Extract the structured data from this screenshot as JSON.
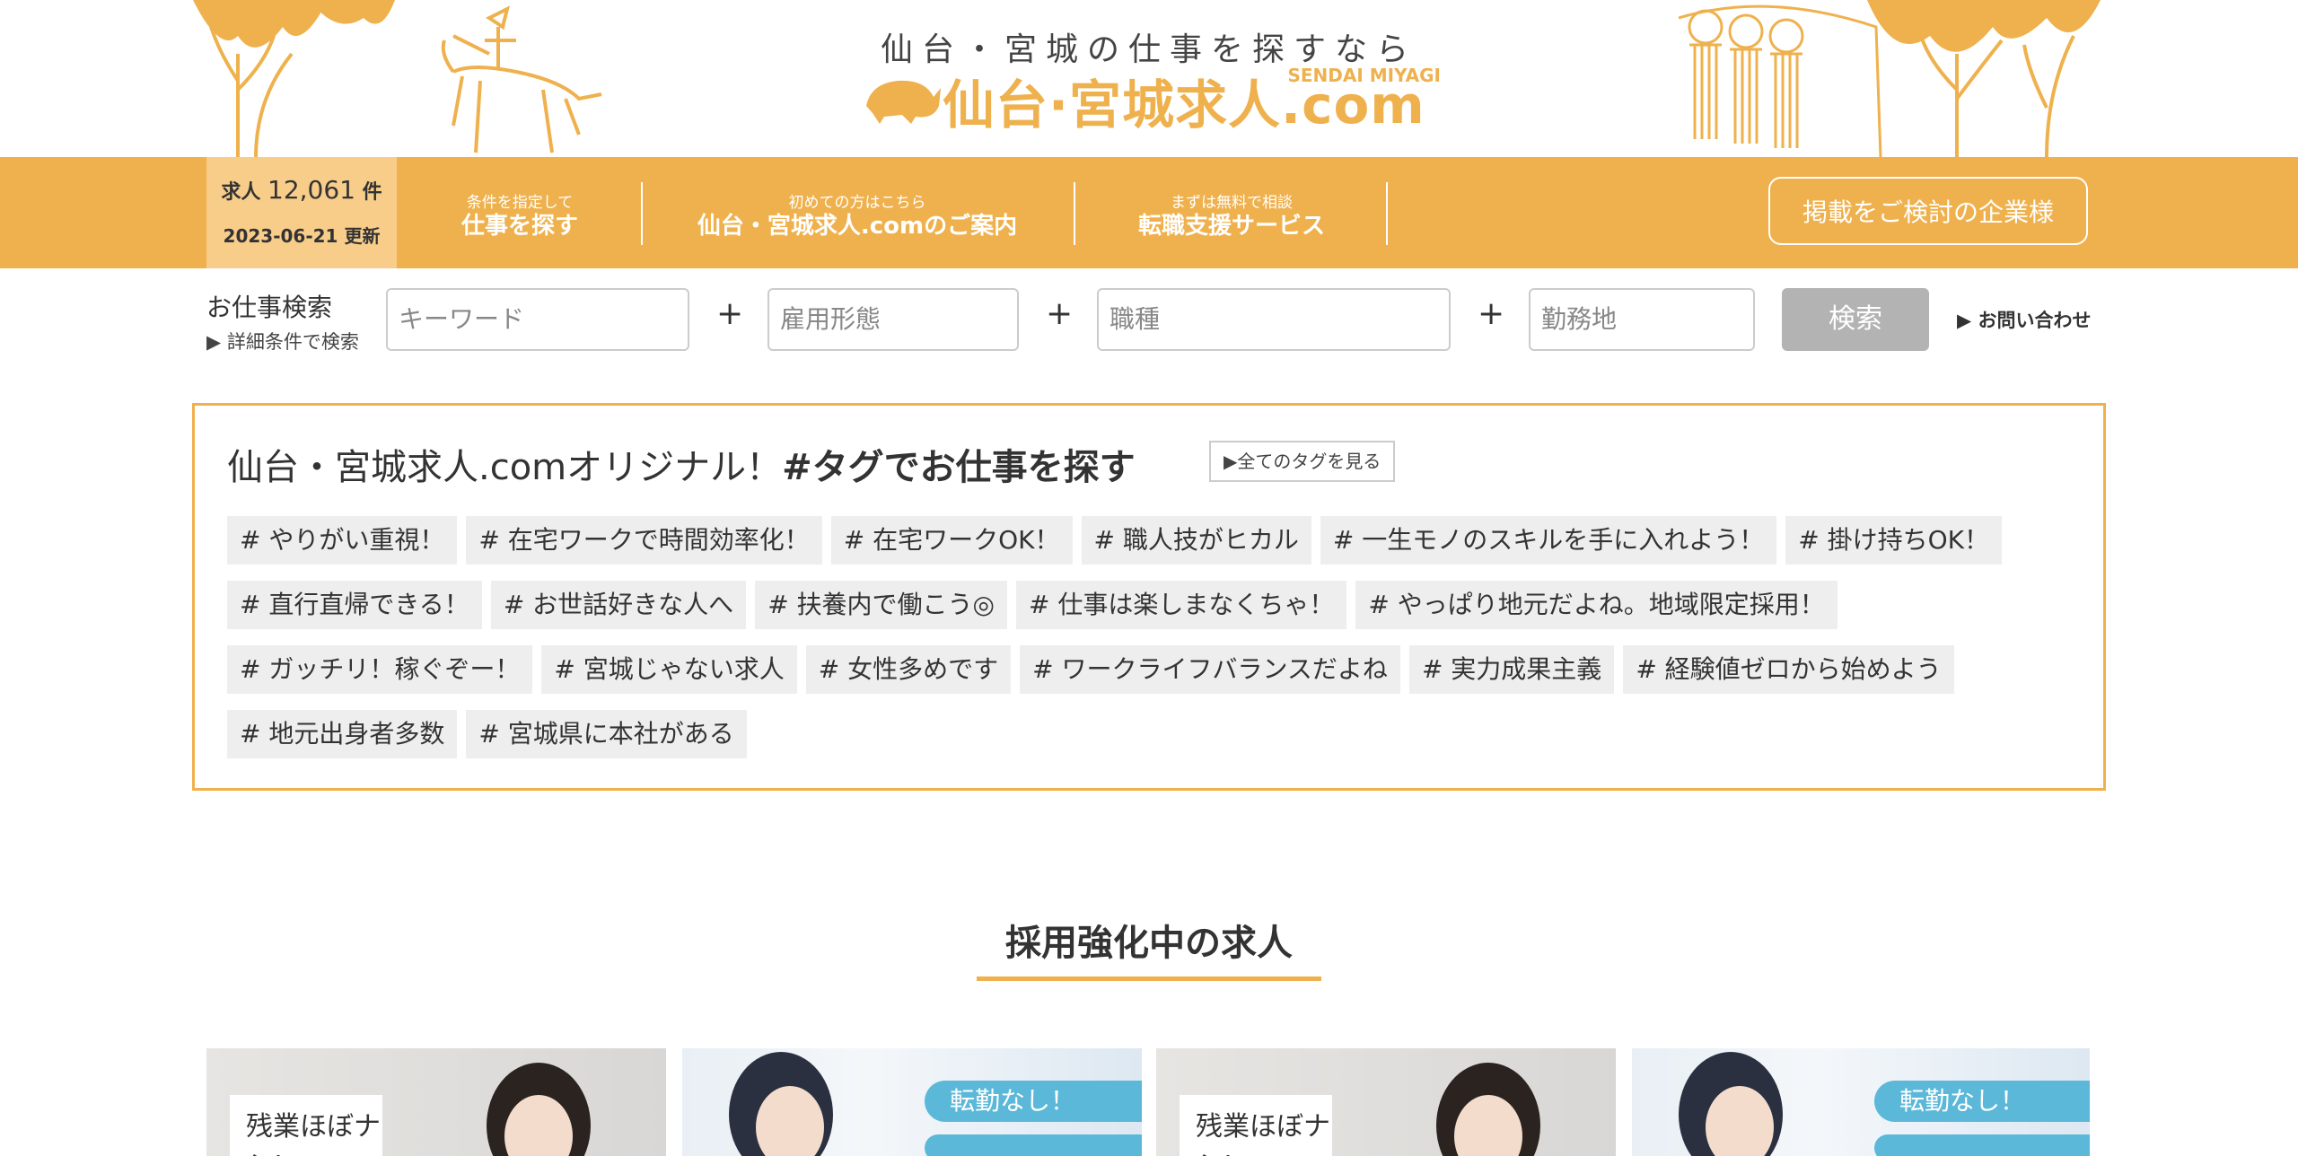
{
  "header": {
    "tagline": "仙台・宮城の仕事を探すなら",
    "logo_text": "仙台·宮城求人.com",
    "logo_sub": "SENDAI MIYAGI"
  },
  "nav": {
    "count_prefix": "求人",
    "count": "12,061",
    "count_suffix": "件",
    "updated": "2023-06-21 更新",
    "items": [
      {
        "small": "条件を指定して",
        "big": "仕事を探す"
      },
      {
        "small": "初めての方はこちら",
        "big": "仙台・宮城求人.comのご案内"
      },
      {
        "small": "まずは無料で相談",
        "big": "転職支援サービス"
      }
    ],
    "cta": "掲載をご検討の企業様"
  },
  "search": {
    "title": "お仕事検索",
    "advanced": "▶ 詳細条件で検索",
    "keyword_placeholder": "キーワード",
    "employment_placeholder": "雇用形態",
    "job_placeholder": "職種",
    "location_placeholder": "勤務地",
    "plus": "+",
    "button": "検索",
    "contact": "▶ お問い合わせ"
  },
  "tags": {
    "heading_plain": "仙台・宮城求人.comオリジナル！",
    "heading_bold": "#タグでお仕事を探す",
    "all_link": "▶全てのタグを見る",
    "items": [
      "# やりがい重視！",
      "# 在宅ワークで時間効率化！",
      "# 在宅ワークOK！",
      "# 職人技がヒカル",
      "# 一生モノのスキルを手に入れよう！",
      "# 掛け持ちOK！",
      "# 直行直帰できる！",
      "# お世話好きな人へ",
      "# 扶養内で働こう◎",
      "# 仕事は楽しまなくちゃ！",
      "# やっぱり地元だよね。地域限定採用！",
      "# ガッチリ！稼ぐぞー！",
      "# 宮城じゃない求人",
      "# 女性多めです",
      "# ワークライフバランスだよね",
      "# 実力成果主義",
      "# 経験値ゼロから始めよう",
      "# 地元出身者多数",
      "# 宮城県に本社がある"
    ]
  },
  "featured": {
    "title": "採用強化中の求人",
    "card_note": "残業ほぼナシ!",
    "card_pill": "転勤なし！"
  },
  "colors": {
    "accent": "#efb14d",
    "count_bg": "#f8cd8a",
    "tag_bg": "#eeeeee",
    "search_button": "#b3b3b3",
    "pill": "#5bb8d9"
  }
}
